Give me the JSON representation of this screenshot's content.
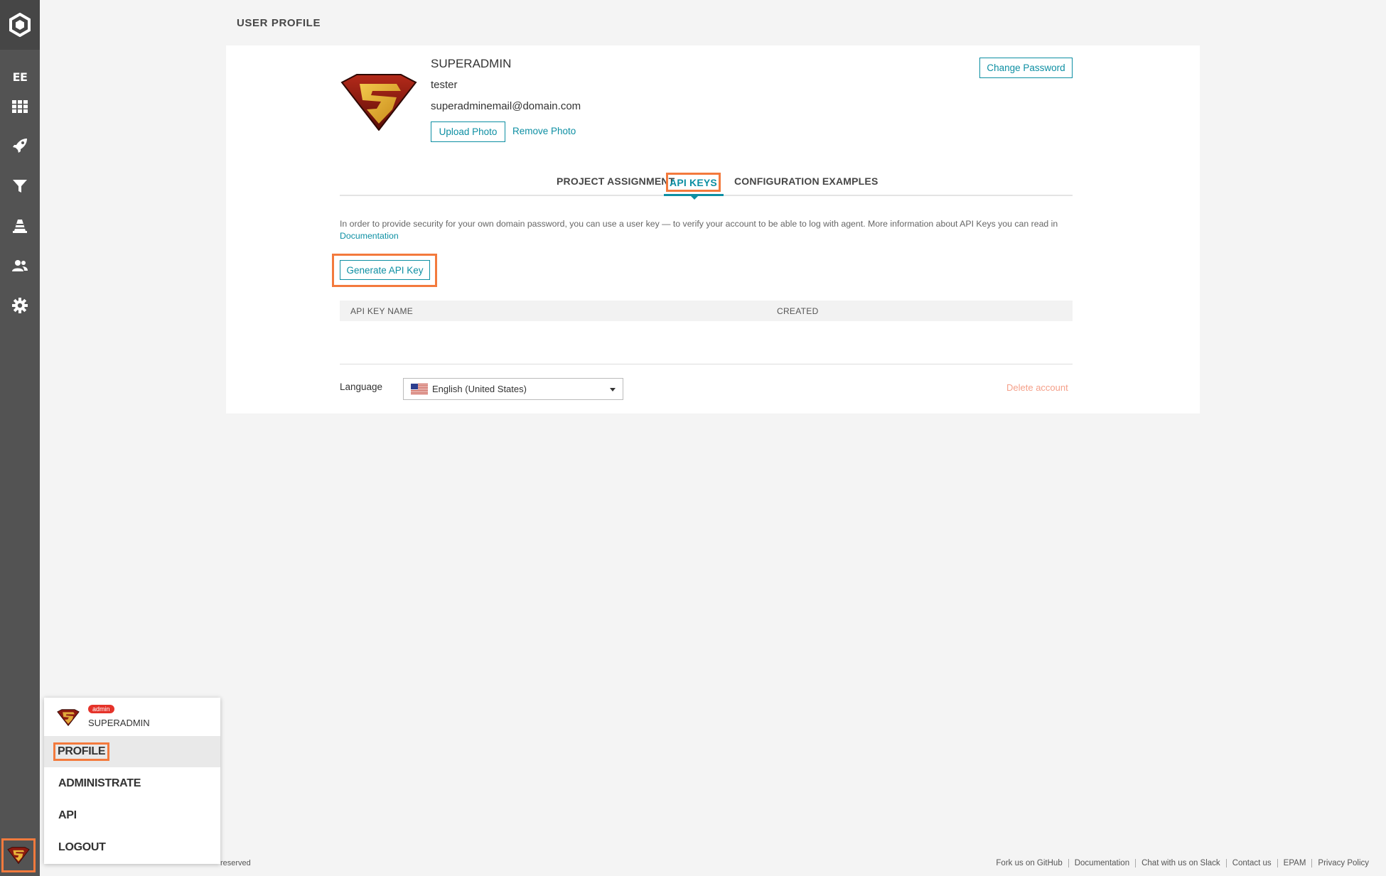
{
  "sidebar": {
    "logo": "reportportal-logo-icon",
    "project_short": "EE",
    "items": [
      {
        "icon": "dashboard-grid-icon"
      },
      {
        "icon": "launches-rocket-icon"
      },
      {
        "icon": "filters-funnel-icon"
      },
      {
        "icon": "debug-cone-icon"
      },
      {
        "icon": "members-icon"
      },
      {
        "icon": "settings-gear-icon"
      }
    ]
  },
  "page": {
    "title": "USER PROFILE"
  },
  "profile": {
    "username": "SUPERADMIN",
    "login": "tester",
    "email": "superadminemail@domain.com",
    "upload_photo": "Upload Photo",
    "remove_photo": "Remove Photo",
    "change_password": "Change Password"
  },
  "tabs": {
    "project_assignment": "PROJECT ASSIGNMENT",
    "api_keys": "API KEYS",
    "configuration_examples": "CONFIGURATION EXAMPLES",
    "active": "API KEYS"
  },
  "api_keys": {
    "info_text": "In order to provide security for your own domain password, you can use a user key — to verify your account to be able to log with agent. More information about API Keys you can read in",
    "info_link": "Documentation",
    "generate_button": "Generate API Key",
    "columns": [
      "API KEY NAME",
      "CREATED"
    ]
  },
  "settings": {
    "language_label": "Language",
    "language_value": "English (United States)",
    "delete_account": "Delete account"
  },
  "user_menu": {
    "badge": "admin",
    "username": "SUPERADMIN",
    "items": [
      "PROFILE",
      "ADMINISTRATE",
      "API",
      "LOGOUT"
    ]
  },
  "footer": {
    "copyright_tail": "reserved",
    "links": [
      "Fork us on GitHub",
      "Documentation",
      "Chat with us on Slack",
      "Contact us",
      "EPAM",
      "Privacy Policy"
    ]
  },
  "colors": {
    "accent": "#0d8fa3",
    "highlight": "#f37a3d",
    "sidebar": "#535353",
    "danger_badge": "#e5332a"
  }
}
